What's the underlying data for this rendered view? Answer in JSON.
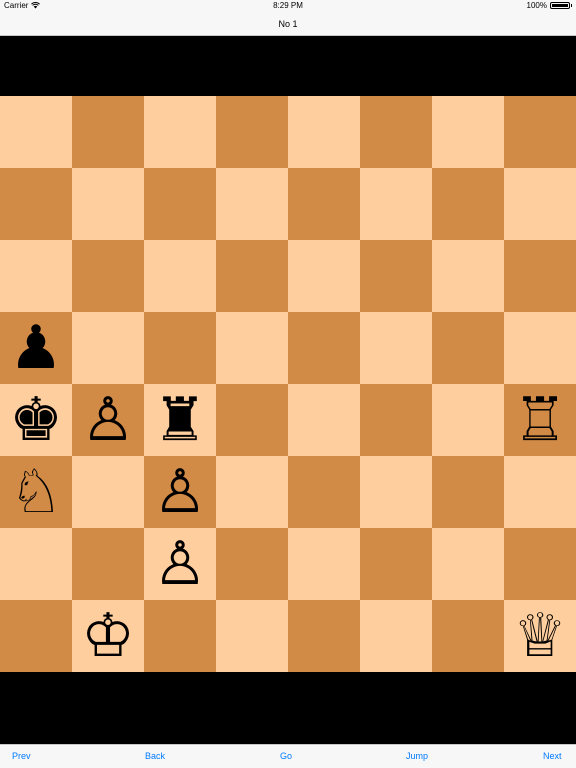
{
  "status_bar": {
    "carrier": "Carrier",
    "wifi_icon": "wifi-icon",
    "time": "8:29 PM",
    "battery_percent": "100%",
    "battery_icon": "battery-icon"
  },
  "nav": {
    "title": "No 1"
  },
  "board": {
    "light_color": "#ffce9e",
    "dark_color": "#d18b47",
    "pieces": [
      {
        "square": "a5",
        "color": "black",
        "type": "pawn",
        "glyph": "♟"
      },
      {
        "square": "a4",
        "color": "black",
        "type": "king",
        "glyph": "♚"
      },
      {
        "square": "b4",
        "color": "white",
        "type": "pawn",
        "glyph": "♙"
      },
      {
        "square": "c4",
        "color": "black",
        "type": "rook",
        "glyph": "♜"
      },
      {
        "square": "h4",
        "color": "white",
        "type": "rook",
        "glyph": "♖"
      },
      {
        "square": "a3",
        "color": "white",
        "type": "knight",
        "glyph": "♘"
      },
      {
        "square": "c3",
        "color": "white",
        "type": "pawn",
        "glyph": "♙"
      },
      {
        "square": "c2",
        "color": "white",
        "type": "pawn",
        "glyph": "♙"
      },
      {
        "square": "b1",
        "color": "white",
        "type": "king",
        "glyph": "♔"
      },
      {
        "square": "h1",
        "color": "white",
        "type": "queen",
        "glyph": "♕"
      }
    ]
  },
  "toolbar": {
    "prev_label": "Prev",
    "back_label": "Back",
    "go_label": "Go",
    "jump_label": "Jump",
    "next_label": "Next",
    "accent_color": "#007aff"
  }
}
